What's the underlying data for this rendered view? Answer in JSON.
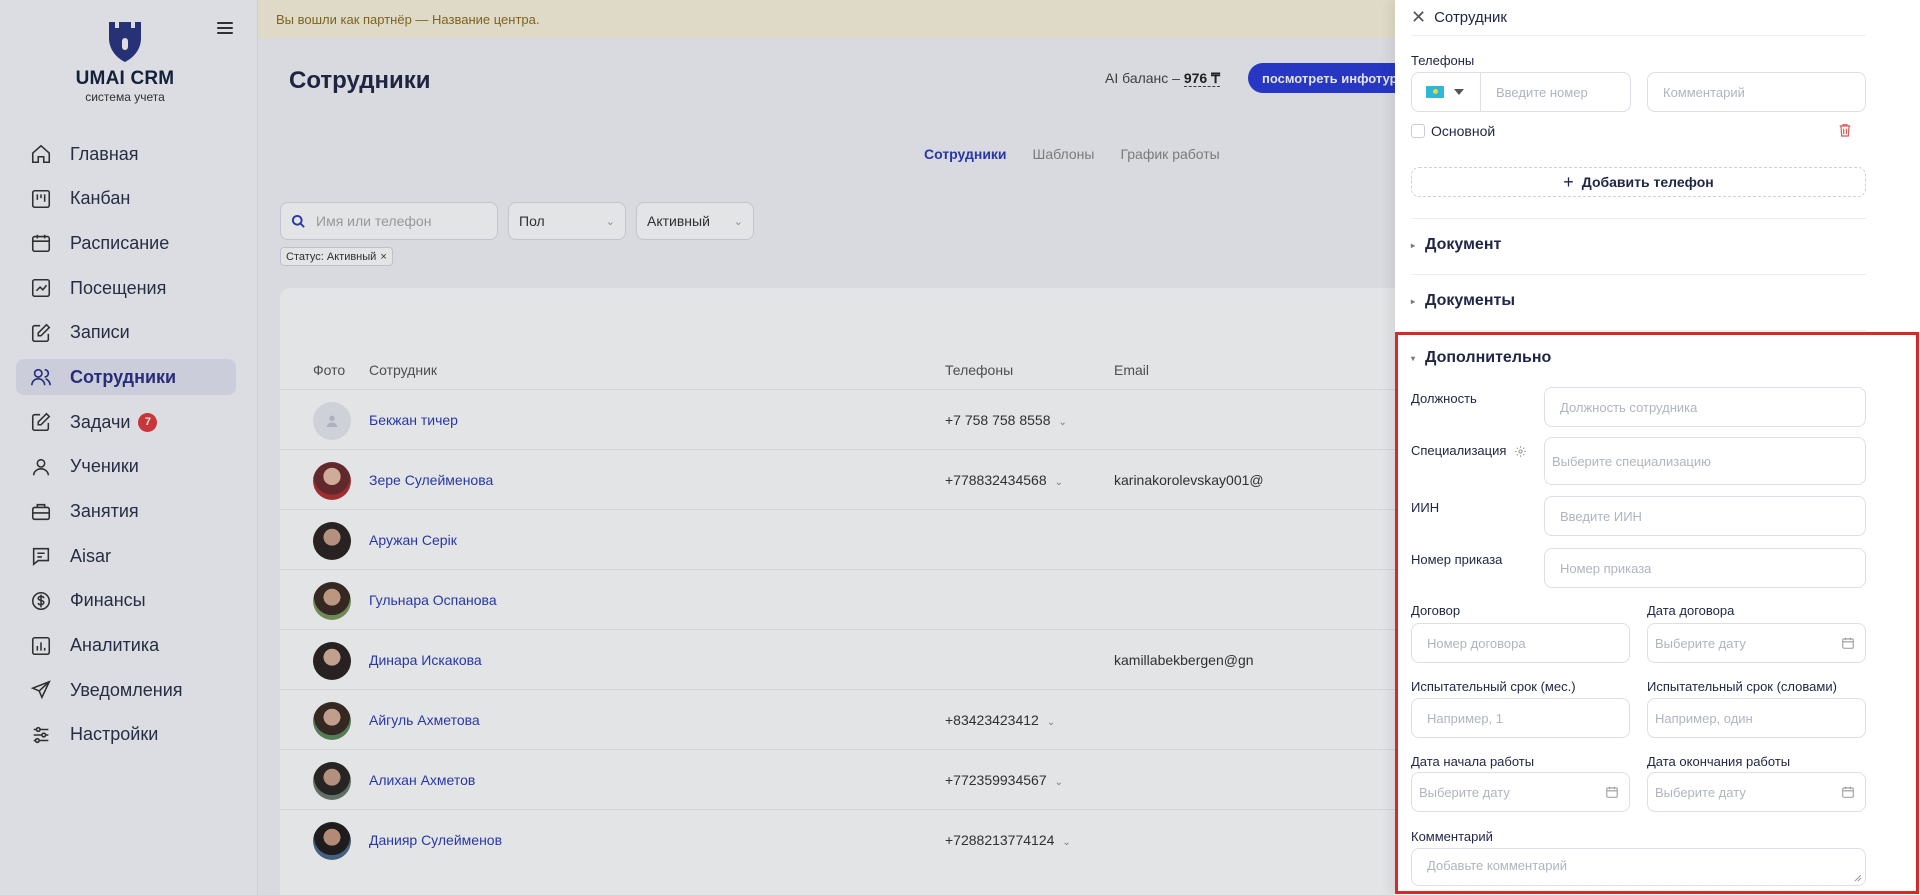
{
  "app": {
    "brand": "UMAI CRM",
    "brand_sub": "система учета"
  },
  "sidebar": {
    "items": [
      {
        "label": "Главная",
        "icon": "home-icon"
      },
      {
        "label": "Канбан",
        "icon": "kanban-icon"
      },
      {
        "label": "Расписание",
        "icon": "calendar-icon"
      },
      {
        "label": "Посещения",
        "icon": "chart-box-icon"
      },
      {
        "label": "Записи",
        "icon": "edit-icon"
      },
      {
        "label": "Сотрудники",
        "icon": "users-icon",
        "active": true
      },
      {
        "label": "Задачи",
        "icon": "tasks-icon",
        "badge": "7"
      },
      {
        "label": "Ученики",
        "icon": "user-icon"
      },
      {
        "label": "Занятия",
        "icon": "briefcase-icon"
      },
      {
        "label": "Aisar",
        "icon": "message-icon"
      },
      {
        "label": "Финансы",
        "icon": "dollar-icon"
      },
      {
        "label": "Аналитика",
        "icon": "analytics-icon"
      },
      {
        "label": "Уведомления",
        "icon": "send-icon"
      },
      {
        "label": "Настройки",
        "icon": "sliders-icon"
      }
    ]
  },
  "banner": {
    "text": "Вы вошли как партнёр — Название центра."
  },
  "header": {
    "title": "Сотрудники",
    "ai_balance_label": "AI баланс –",
    "ai_balance_value": "976 ₸",
    "info_button": "посмотреть инфотур"
  },
  "tabs": [
    "Сотрудники",
    "Шаблоны",
    "График работы"
  ],
  "filters": {
    "search_placeholder": "Имя или телефон",
    "gender": "Пол",
    "status": "Активный",
    "chip": "Статус: Активный"
  },
  "table": {
    "columns": {
      "photo": "Фото",
      "employee": "Сотрудник",
      "phones": "Телефоны",
      "email": "Email"
    },
    "rows": [
      {
        "name": "Бекжан тичер",
        "phone": "+7 758 758 8558",
        "email": ""
      },
      {
        "name": "Зере Сулейменова",
        "phone": "+778832434568",
        "email": "karinakorolevskay001@"
      },
      {
        "name": "Аружан Серік",
        "phone": "",
        "email": ""
      },
      {
        "name": "Гульнара Оспанова",
        "phone": "",
        "email": ""
      },
      {
        "name": "Динара Искакова",
        "phone": "",
        "email": "kamillabekbergen@gn"
      },
      {
        "name": "Айгуль Ахметова",
        "phone": "+83423423412",
        "email": ""
      },
      {
        "name": "Алихан Ахметов",
        "phone": "+772359934567",
        "email": ""
      },
      {
        "name": "Данияр Сулейменов",
        "phone": "+7288213774124",
        "email": ""
      }
    ]
  },
  "drawer": {
    "title": "Сотрудник",
    "phones_label": "Телефоны",
    "phone_placeholder": "Введите номер",
    "comment_placeholder": "Комментарий",
    "primary_label": "Основной",
    "add_phone": "Добавить телефон",
    "section_document": "Документ",
    "section_documents": "Документы",
    "section_additional": "Дополнительно",
    "position_label": "Должность",
    "position_placeholder": "Должность сотрудника",
    "specialization_label": "Специализация",
    "specialization_placeholder": "Выберите специализацию",
    "iin_label": "ИИН",
    "iin_placeholder": "Введите ИИН",
    "order_label": "Номер приказа",
    "order_placeholder": "Номер приказа",
    "contract_label": "Договор",
    "contract_placeholder": "Номер договора",
    "contract_date_label": "Дата договора",
    "date_placeholder": "Выберите дату",
    "probation_months_label": "Испытательный срок (мес.)",
    "probation_months_placeholder": "Например, 1",
    "probation_words_label": "Испытательный срок (словами)",
    "probation_words_placeholder": "Например, один",
    "start_date_label": "Дата начала работы",
    "end_date_label": "Дата окончания работы",
    "comment_label": "Комментарий",
    "comment_area_placeholder": "Добавьте комментарий"
  },
  "colors": {
    "accent": "#2b3bb8",
    "highlight_border": "#d62a2a",
    "badge": "#e03a3a"
  }
}
